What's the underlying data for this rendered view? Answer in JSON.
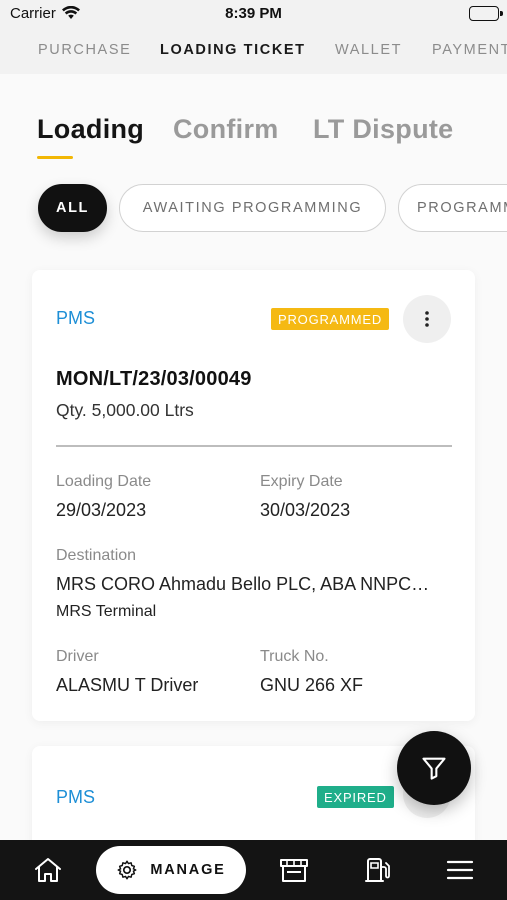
{
  "status_bar": {
    "carrier": "Carrier",
    "time": "8:39 PM"
  },
  "top_nav": [
    "PURCHASE",
    "LOADING TICKET",
    "WALLET",
    "PAYMENT"
  ],
  "tabs": [
    "Loading",
    "Confirm",
    "LT Dispute"
  ],
  "filters": [
    "ALL",
    "AWAITING PROGRAMMING",
    "PROGRAMMED"
  ],
  "cards": [
    {
      "product": "PMS",
      "status": "PROGRAMMED",
      "ticket_no": "MON/LT/23/03/00049",
      "qty": "Qty. 5,000.00 Ltrs",
      "loading_date_label": "Loading Date",
      "loading_date": "29/03/2023",
      "expiry_date_label": "Expiry Date",
      "expiry_date": "30/03/2023",
      "destination_label": "Destination",
      "destination": "MRS CORO Ahmadu Bello PLC, ABA NNPC…",
      "terminal": "MRS Terminal",
      "driver_label": "Driver",
      "driver": "ALASMU T Driver",
      "truck_label": "Truck No.",
      "truck_no": "GNU 266 XF"
    },
    {
      "product": "PMS",
      "status": "EXPIRED"
    }
  ],
  "bottom_nav": {
    "manage_label": "MANAGE",
    "icons": [
      "home-icon",
      "gear-icon",
      "store-icon",
      "fuel-pump-icon",
      "menu-icon"
    ]
  },
  "colors": {
    "accent_underline": "#f2b705",
    "programmed_badge": "#f5b913",
    "expired_badge": "#1fae8a",
    "product_link": "#1e8fd6",
    "bottom_bar": "#141414"
  }
}
